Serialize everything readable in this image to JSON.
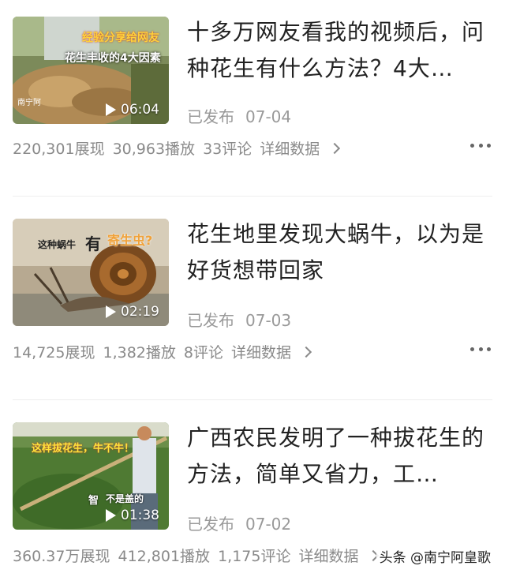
{
  "items": [
    {
      "title": "十多万网友看我的视频后，问种花生有什么方法？4大…",
      "status": "已发布",
      "date": "07-04",
      "duration": "06:04",
      "thumb_text_1": "经验分享给网友",
      "thumb_text_2": "花生丰收的4大因素",
      "thumb_text_3": "南宁阿",
      "impressions": "220,301展现",
      "plays": "30,963播放",
      "comments": "33评论",
      "detail": "详细数据"
    },
    {
      "title": "花生地里发现大蜗牛，以为是好货想带回家",
      "status": "已发布",
      "date": "07-03",
      "duration": "02:19",
      "thumb_text_1": "这种蜗牛",
      "thumb_text_2": "有",
      "thumb_text_3": "寄生虫?",
      "impressions": "14,725展现",
      "plays": "1,382播放",
      "comments": "8评论",
      "detail": "详细数据"
    },
    {
      "title": "广西农民发明了一种拔花生的方法，简单又省力，工…",
      "status": "已发布",
      "date": "07-02",
      "duration": "01:38",
      "thumb_text_1": "这样拔花生，牛不牛！",
      "thumb_text_2": "智",
      "thumb_text_3": "不是盖的",
      "impressions": "360.37万展现",
      "plays": "412,801播放",
      "comments": "1,175评论",
      "detail": "详细数据"
    }
  ],
  "watermark": "头条 @南宁阿皇歌",
  "colors": {
    "muted": "#8a8a8a",
    "title": "#222222",
    "divider": "#eeeeee"
  }
}
